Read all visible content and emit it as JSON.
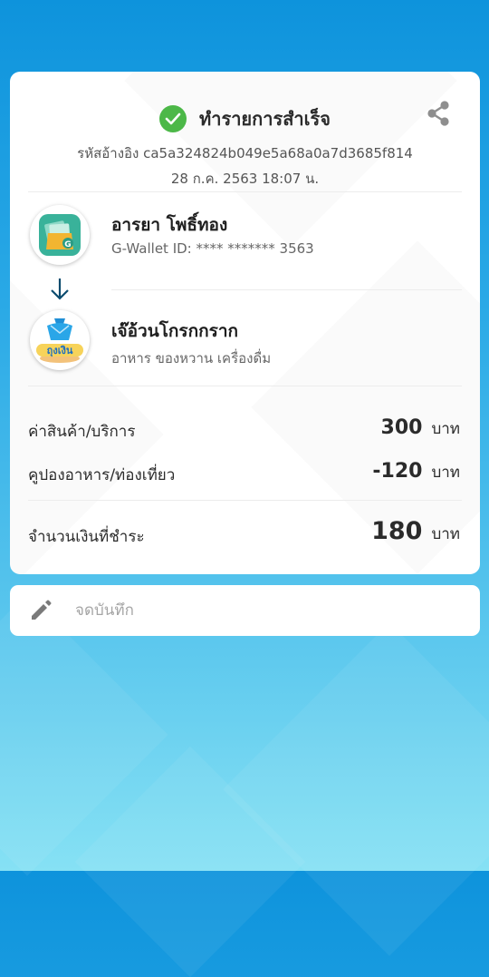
{
  "status": {
    "title": "ทำรายการสำเร็จ",
    "icon": "check-circle-icon",
    "icon_color": "#4cb848"
  },
  "share": {
    "icon": "share-icon"
  },
  "reference": {
    "text": "รหัสอ้างอิง ca5a324824b049e5a68a0a7d3685f814"
  },
  "datetime": {
    "text": "28 ก.ค. 2563 18:07 น."
  },
  "sender": {
    "name": "อารยา โพธิ์ทอง",
    "sub": "G-Wallet ID: **** ******* 3563",
    "avatar_icon": "g-wallet-icon"
  },
  "transfer_arrow": {
    "icon": "arrow-down-icon"
  },
  "receiver": {
    "name": "เจ๊อ้วนโกรกกราก",
    "sub": "อาหาร ของหวาน เครื่องดื่ม",
    "avatar_icon": "thung-ngoen-logo",
    "logo_text": "ถุงเงิน"
  },
  "lines": [
    {
      "label": "ค่าสินค้า/บริการ",
      "amount": "300",
      "unit": "บาท"
    },
    {
      "label": "คูปองอาหาร/ท่องเที่ยว",
      "amount": "-120",
      "unit": "บาท"
    }
  ],
  "total": {
    "label": "จำนวนเงินที่ชำระ",
    "amount": "180",
    "unit": "บาท"
  },
  "note": {
    "placeholder": "จดบันทึก",
    "value": "",
    "icon": "pencil-icon"
  },
  "colors": {
    "accent_green": "#4cb848",
    "background_top": "#0e93dc",
    "background_bottom": "#86e1f4",
    "arrow": "#0b4b6e"
  }
}
